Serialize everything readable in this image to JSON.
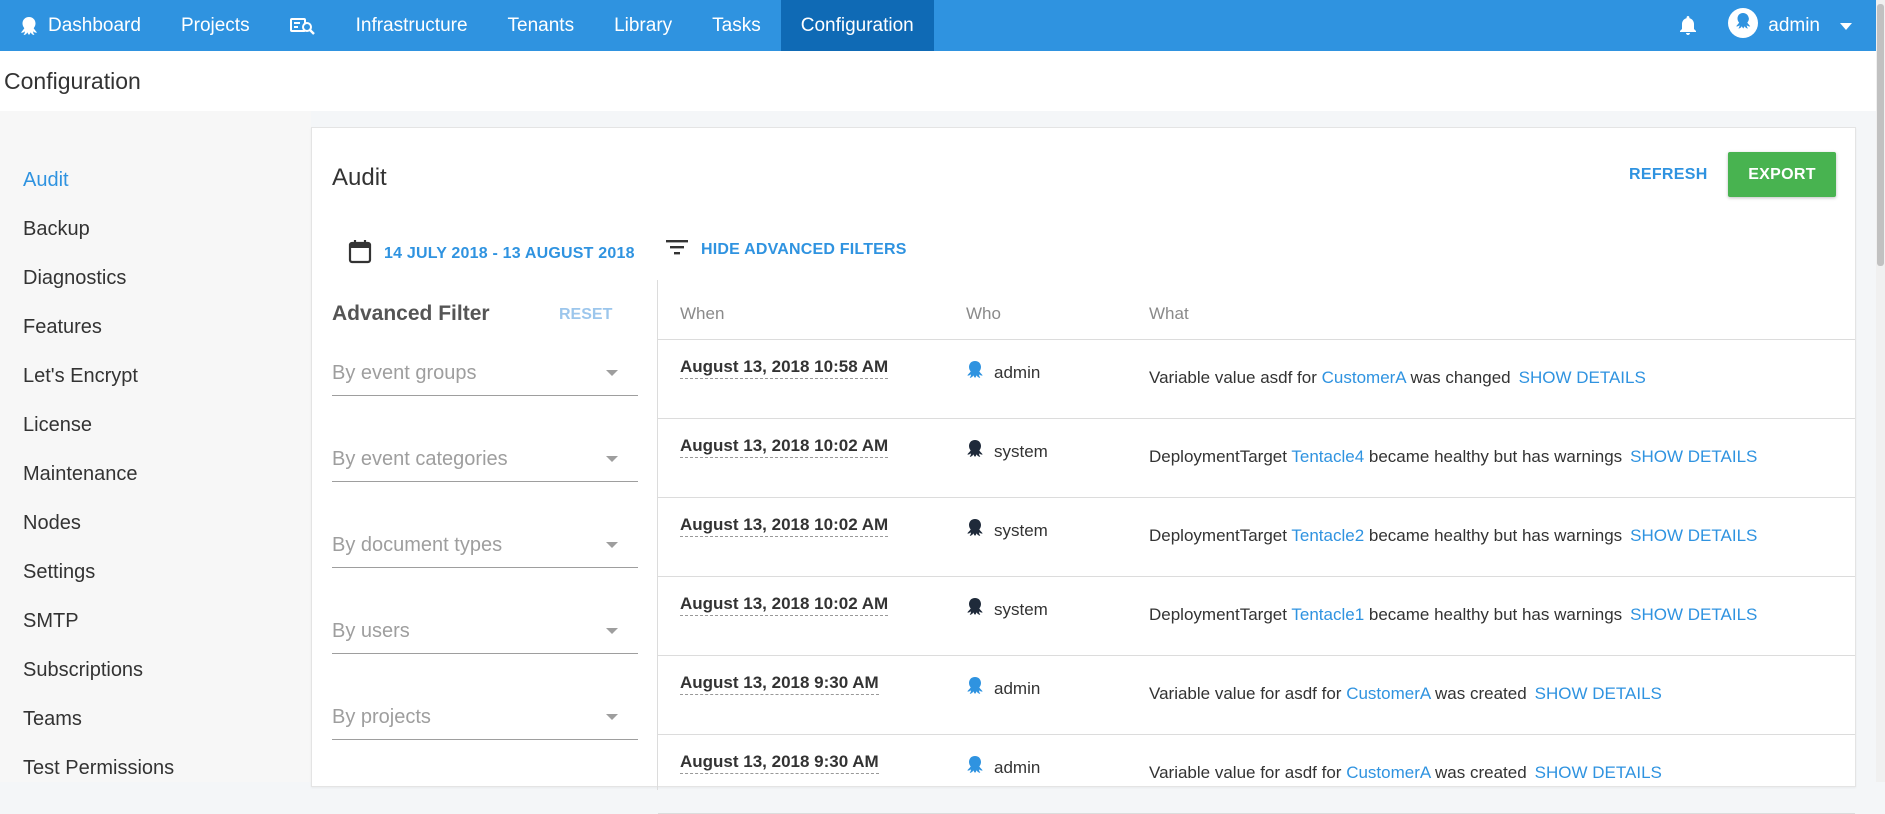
{
  "nav": {
    "dashboard": "Dashboard",
    "projects": "Projects",
    "infrastructure": "Infrastructure",
    "tenants": "Tenants",
    "library": "Library",
    "tasks": "Tasks",
    "configuration": "Configuration",
    "user": "admin",
    "icons": [
      "octopus-logo-icon",
      "search-icon",
      "bell-icon",
      "user-avatar-icon",
      "chevron-down-icon"
    ]
  },
  "page": {
    "title": "Configuration"
  },
  "sidebar": {
    "items": [
      {
        "label": "Audit",
        "active": true
      },
      {
        "label": "Backup"
      },
      {
        "label": "Diagnostics"
      },
      {
        "label": "Features"
      },
      {
        "label": "Let's Encrypt"
      },
      {
        "label": "License"
      },
      {
        "label": "Maintenance"
      },
      {
        "label": "Nodes"
      },
      {
        "label": "Settings"
      },
      {
        "label": "SMTP"
      },
      {
        "label": "Subscriptions"
      },
      {
        "label": "Teams"
      },
      {
        "label": "Test Permissions"
      }
    ]
  },
  "audit": {
    "title": "Audit",
    "refresh": "REFRESH",
    "export": "EXPORT",
    "date_range": "14 JULY 2018 - 13 AUGUST 2018",
    "hide_filters": "HIDE ADVANCED FILTERS"
  },
  "filters": {
    "title": "Advanced Filter",
    "reset": "RESET",
    "selects": [
      "By event groups",
      "By event categories",
      "By document types",
      "By users",
      "By projects"
    ]
  },
  "table": {
    "headers": {
      "when": "When",
      "who": "Who",
      "what": "What"
    },
    "rows": [
      {
        "when": "August 13, 2018 10:58 AM",
        "who": "admin",
        "pre": "Variable value asdf for ",
        "entity": "CustomerA",
        "post": " was changed",
        "details": "SHOW DETAILS"
      },
      {
        "when": "August 13, 2018 10:02 AM",
        "who": "system",
        "pre": "DeploymentTarget ",
        "entity": "Tentacle4",
        "post": " became healthy but has warnings",
        "details": "SHOW DETAILS"
      },
      {
        "when": "August 13, 2018 10:02 AM",
        "who": "system",
        "pre": "DeploymentTarget ",
        "entity": "Tentacle2",
        "post": " became healthy but has warnings",
        "details": "SHOW DETAILS"
      },
      {
        "when": "August 13, 2018 10:02 AM",
        "who": "system",
        "pre": "DeploymentTarget ",
        "entity": "Tentacle1",
        "post": " became healthy but has warnings",
        "details": "SHOW DETAILS"
      },
      {
        "when": "August 13, 2018 9:30 AM",
        "who": "admin",
        "pre": "Variable value for asdf for ",
        "entity": "CustomerA",
        "post": " was created",
        "details": "SHOW DETAILS"
      },
      {
        "when": "August 13, 2018 9:30 AM",
        "who": "admin",
        "pre": "Variable value for asdf for ",
        "entity": "CustomerA",
        "post": " was created",
        "details": "SHOW DETAILS"
      }
    ]
  },
  "colors": {
    "primary": "#2f93e0",
    "active_nav": "#0f6ab5",
    "export": "#48b350",
    "admin_icon": "#2f93e0",
    "system_icon": "#1f2a3a"
  }
}
